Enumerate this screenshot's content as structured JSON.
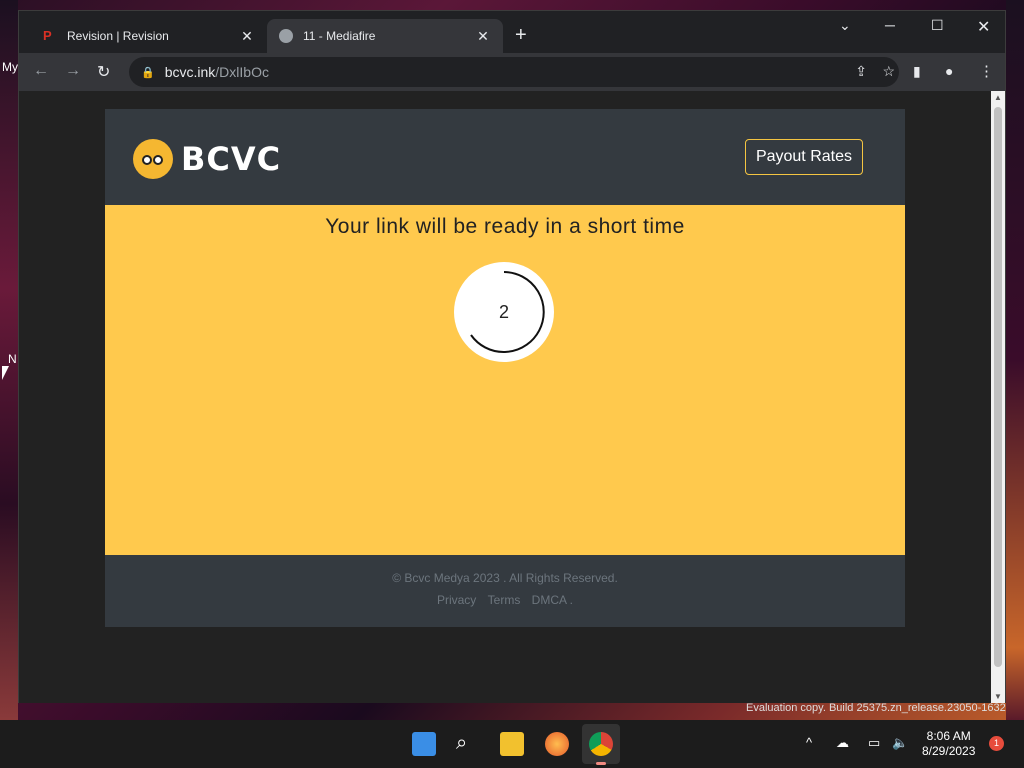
{
  "desktop": {
    "left_label": "My",
    "n_label": "N"
  },
  "browser": {
    "tabs": [
      {
        "title": "Revision | Revision",
        "active": false
      },
      {
        "title": "11 - Mediafire",
        "active": true
      }
    ],
    "new_tab": "+",
    "url_host": "bcvc.ink",
    "url_path": "/DxlIbOc"
  },
  "page": {
    "logo_text": "BCVC",
    "payout_label": "Payout Rates",
    "ready_message": "Your link will be ready in a short time",
    "countdown": "2",
    "copyright": "© Bcvc Medya 2023 . All Rights Reserved.",
    "footer_links": [
      "Privacy",
      "Terms",
      "DMCA ."
    ]
  },
  "taskbar": {
    "watermark": "Evaluation copy. Build 25375.zn_release.23050-1632",
    "time": "8:06 AM",
    "date": "8/29/2023",
    "notifications": "1"
  }
}
